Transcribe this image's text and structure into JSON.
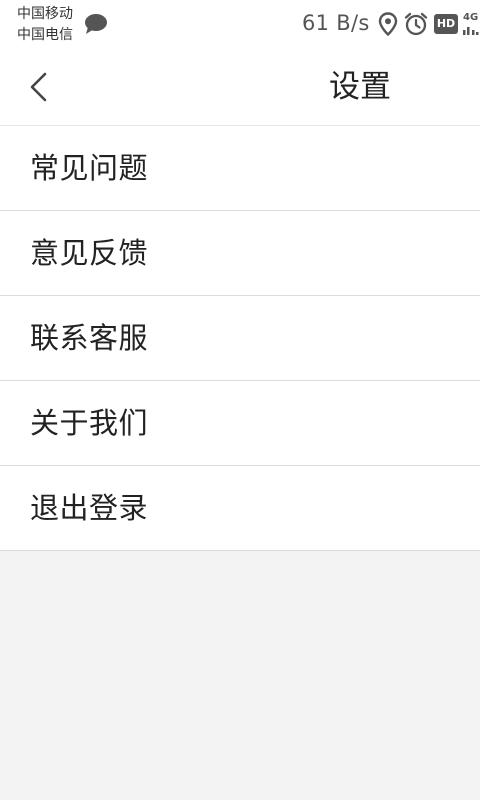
{
  "status_bar": {
    "carrier_1": "中国移动",
    "carrier_2": "中国电信",
    "speed": "61 B/s",
    "hd_badge": "HD",
    "network_type": "4G",
    "icons": [
      "chat-bubble-icon",
      "location-icon",
      "alarm-icon",
      "hd-icon",
      "signal-icon"
    ]
  },
  "header": {
    "title": "设置",
    "back_icon": "chevron-left-icon"
  },
  "menu": {
    "items": [
      {
        "label": "常见问题"
      },
      {
        "label": "意见反馈"
      },
      {
        "label": "联系客服"
      },
      {
        "label": "关于我们"
      },
      {
        "label": "退出登录"
      }
    ]
  },
  "colors": {
    "background": "#f2f3f2",
    "surface": "#ffffff",
    "divider": "#dcdcdc",
    "text": "#222222",
    "status_icons": "#555555"
  }
}
